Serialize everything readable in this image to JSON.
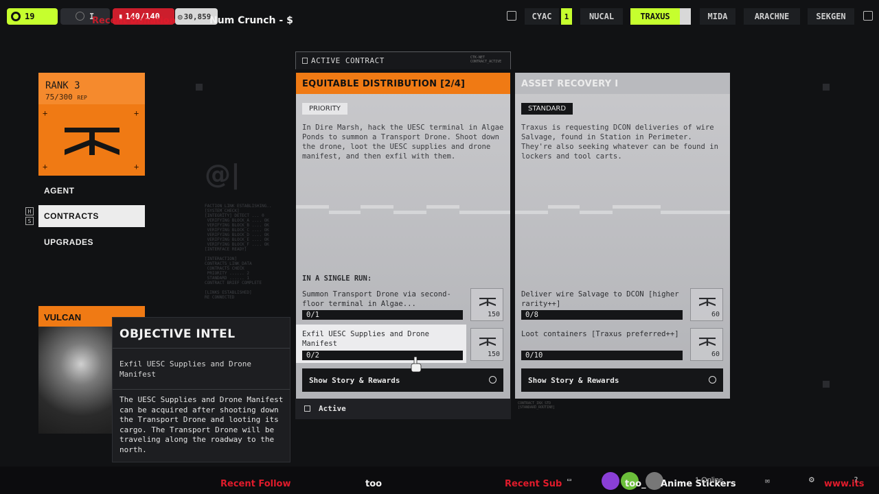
{
  "topbar": {
    "level": "19",
    "status_letter": "I",
    "health": "140/140",
    "credits": "30,859",
    "overlay_red": "Recent Donation",
    "room_title": "Num Crunch - $",
    "factions": [
      {
        "label": "CYAC",
        "badge": "1",
        "active": false
      },
      {
        "label": "NUCAL",
        "badge": "",
        "active": false
      },
      {
        "label": "TRAXUS",
        "badge": "",
        "active": true
      },
      {
        "label": "MIDA",
        "badge": "",
        "active": false
      },
      {
        "label": "ARACHNE",
        "badge": "",
        "active": false
      },
      {
        "label": "SEKGEN",
        "badge": "",
        "active": false
      }
    ]
  },
  "rank": {
    "title": "RANK 3",
    "progress": "75/300",
    "unit": "REP"
  },
  "nav": {
    "items": [
      "AGENT",
      "CONTRACTS",
      "UPGRADES"
    ],
    "active_index": 1,
    "hotkeys": [
      "H",
      "S"
    ]
  },
  "vulcan": {
    "name": "VULCAN"
  },
  "tooltip": {
    "title": "OBJECTIVE INTEL",
    "subtitle": "Exfil UESC Supplies and Drone Manifest",
    "body": "The UESC Supplies and Drone Manifest can be acquired after shooting down the Transport Drone and looting its cargo. The Transport Drone will be traveling along the roadway to the north."
  },
  "background": {
    "ghost_logo": "@|",
    "ghost_text": "FACTION_LINK ESTABLISHING..\n[SYSTEM_CHECK]\n[INTEGRITY] DETECT ... 0\n VERIFYING BLOCK_A .... OK\n VERIFYING BLOCK_B .... OK\n VERIFYING BLOCK_C .... OK\n VERIFYING BLOCK_D .... OK\n VERIFYING BLOCK_E .... OK\n VERIFYING BLOCK_F .... OK\n[INTERFACE READY]\n\n[INTERACTION]\nCONTRACTS_LINK_DATA\n CONTRACTS CHECK\n PRIORITY ...... 2\n STANDARD ...... 1\nCONTRACT BRIEF COMPLETE\n\n[LINKS ESTABLISHED]\nRE CONNECTED"
  },
  "active_contract": {
    "label": "ACTIVE CONTRACT",
    "meta": "CTK-NET\nCONTRACT_ACTIVE",
    "footer": "Active"
  },
  "contracts": [
    {
      "title": "EQUITABLE DISTRIBUTION [2/4]",
      "tag": "PRIORITY",
      "description": "In Dire Marsh, hack the UESC terminal in Algae Ponds to summon a Transport Drone. Shoot down the drone, loot the UESC supplies and drone manifest, and then exfil with them.",
      "run_label": "IN A SINGLE RUN:",
      "objectives": [
        {
          "text": "Summon Transport Drone via second-floor terminal in Algae...",
          "progress": "0/1",
          "reward": "150"
        },
        {
          "text": "Exfil UESC Supplies and Drone Manifest",
          "progress": "0/2",
          "reward": "150"
        }
      ],
      "button": "Show Story & Rewards"
    },
    {
      "title": "ASSET RECOVERY I",
      "tag": "STANDARD",
      "description": "Traxus is requesting DCON deliveries of wire Salvage, found in Station in Perimeter. They're also seeking whatever can be found in lockers and tool carts.",
      "run_label": "",
      "objectives": [
        {
          "text": "Deliver wire Salvage to DCON [higher rarity++]",
          "progress": "0/8",
          "reward": "60"
        },
        {
          "text": "Loot containers [Traxus preferred++]",
          "progress": "0/10",
          "reward": "60"
        }
      ],
      "button": "Show Story & Rewards",
      "meta": "CONTRACT_INX_STD\n[STANDARD_ROUTINE]"
    }
  ],
  "stream_bar": {
    "recent_follow_label": "Recent Follow",
    "recent_follow_name": "too",
    "recent_sub_label": "Recent Sub",
    "recent_sub_name": "too_",
    "sticker_text": "Anime Stickers",
    "online": "1 Online",
    "url_fragment": "www.its"
  },
  "colors": {
    "accent_green": "#c6ff2e",
    "accent_orange": "#f07a14",
    "health_red": "#cc1e2c",
    "stream_red": "#e01b2b"
  }
}
